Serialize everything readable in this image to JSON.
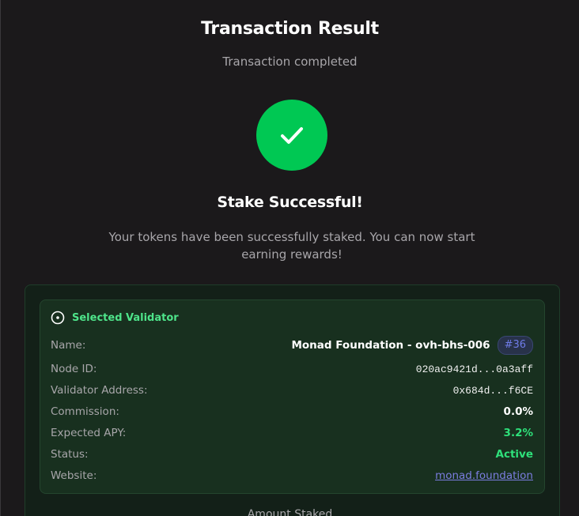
{
  "page": {
    "title": "Transaction Result",
    "subtitle": "Transaction completed"
  },
  "result": {
    "icon": "check-icon",
    "success_color": "#00c853",
    "heading": "Stake Successful!",
    "description": "Your tokens have been successfully staked. You can now start earning rewards!"
  },
  "validator": {
    "section_title": "Selected Validator",
    "section_icon": "target-circle-icon",
    "accent_color": "#4ee48a",
    "rows": {
      "name": {
        "label": "Name:",
        "value": "Monad Foundation - ovh-bhs-006",
        "badge": "#36"
      },
      "node_id": {
        "label": "Node ID:",
        "value": "020ac9421d...0a3aff"
      },
      "address": {
        "label": "Validator Address:",
        "value": "0x684d...f6CE"
      },
      "commission": {
        "label": "Commission:",
        "value": "0.0%"
      },
      "apy": {
        "label": "Expected APY:",
        "value": "3.2%"
      },
      "status": {
        "label": "Status:",
        "value": "Active"
      },
      "website": {
        "label": "Website:",
        "value": "monad.foundation"
      }
    }
  },
  "amount": {
    "label": "Amount Staked"
  }
}
